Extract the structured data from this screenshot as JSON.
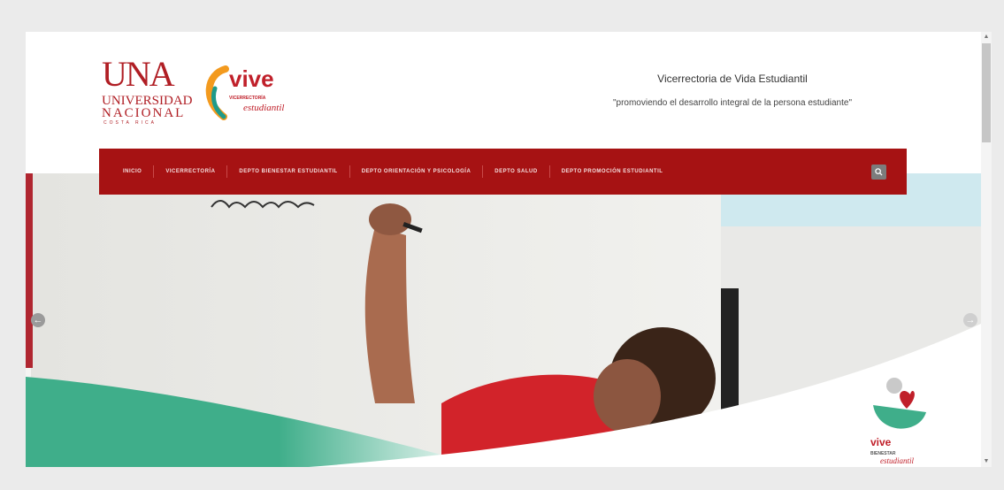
{
  "header": {
    "logo_una": {
      "big": "UNA",
      "line1": "UNIVERSIDAD",
      "line2": "NACIONAL",
      "country": "COSTA RICA"
    },
    "logo_vive": {
      "word": "vive",
      "sub": "VICERRECTORÍA",
      "sub2": "estudiantil"
    },
    "title": "Vicerrectoria de Vida Estudiantil",
    "slogan": "\"promoviendo el desarrollo integral de la persona estudiante\""
  },
  "nav": {
    "items": [
      {
        "label": "INICIO"
      },
      {
        "label": "VICERRECTORÍA"
      },
      {
        "label": "DEPTO BIENESTAR ESTUDIANTIL"
      },
      {
        "label": "DEPTO ORIENTACIÓN Y PSICOLOGÍA"
      },
      {
        "label": "DEPTO SALUD"
      },
      {
        "label": "DEPTO PROMOCIÓN ESTUDIANTIL"
      }
    ],
    "search_icon": "search-icon"
  },
  "slider": {
    "prev_icon": "arrow-left-icon",
    "next_icon": "arrow-right-icon",
    "badge": {
      "word": "vive",
      "line1": "BIENESTAR",
      "line2": "estudiantil"
    }
  },
  "colors": {
    "brand_red": "#a61213",
    "logo_red": "#c0202a",
    "accent_green": "#3fae8a"
  }
}
